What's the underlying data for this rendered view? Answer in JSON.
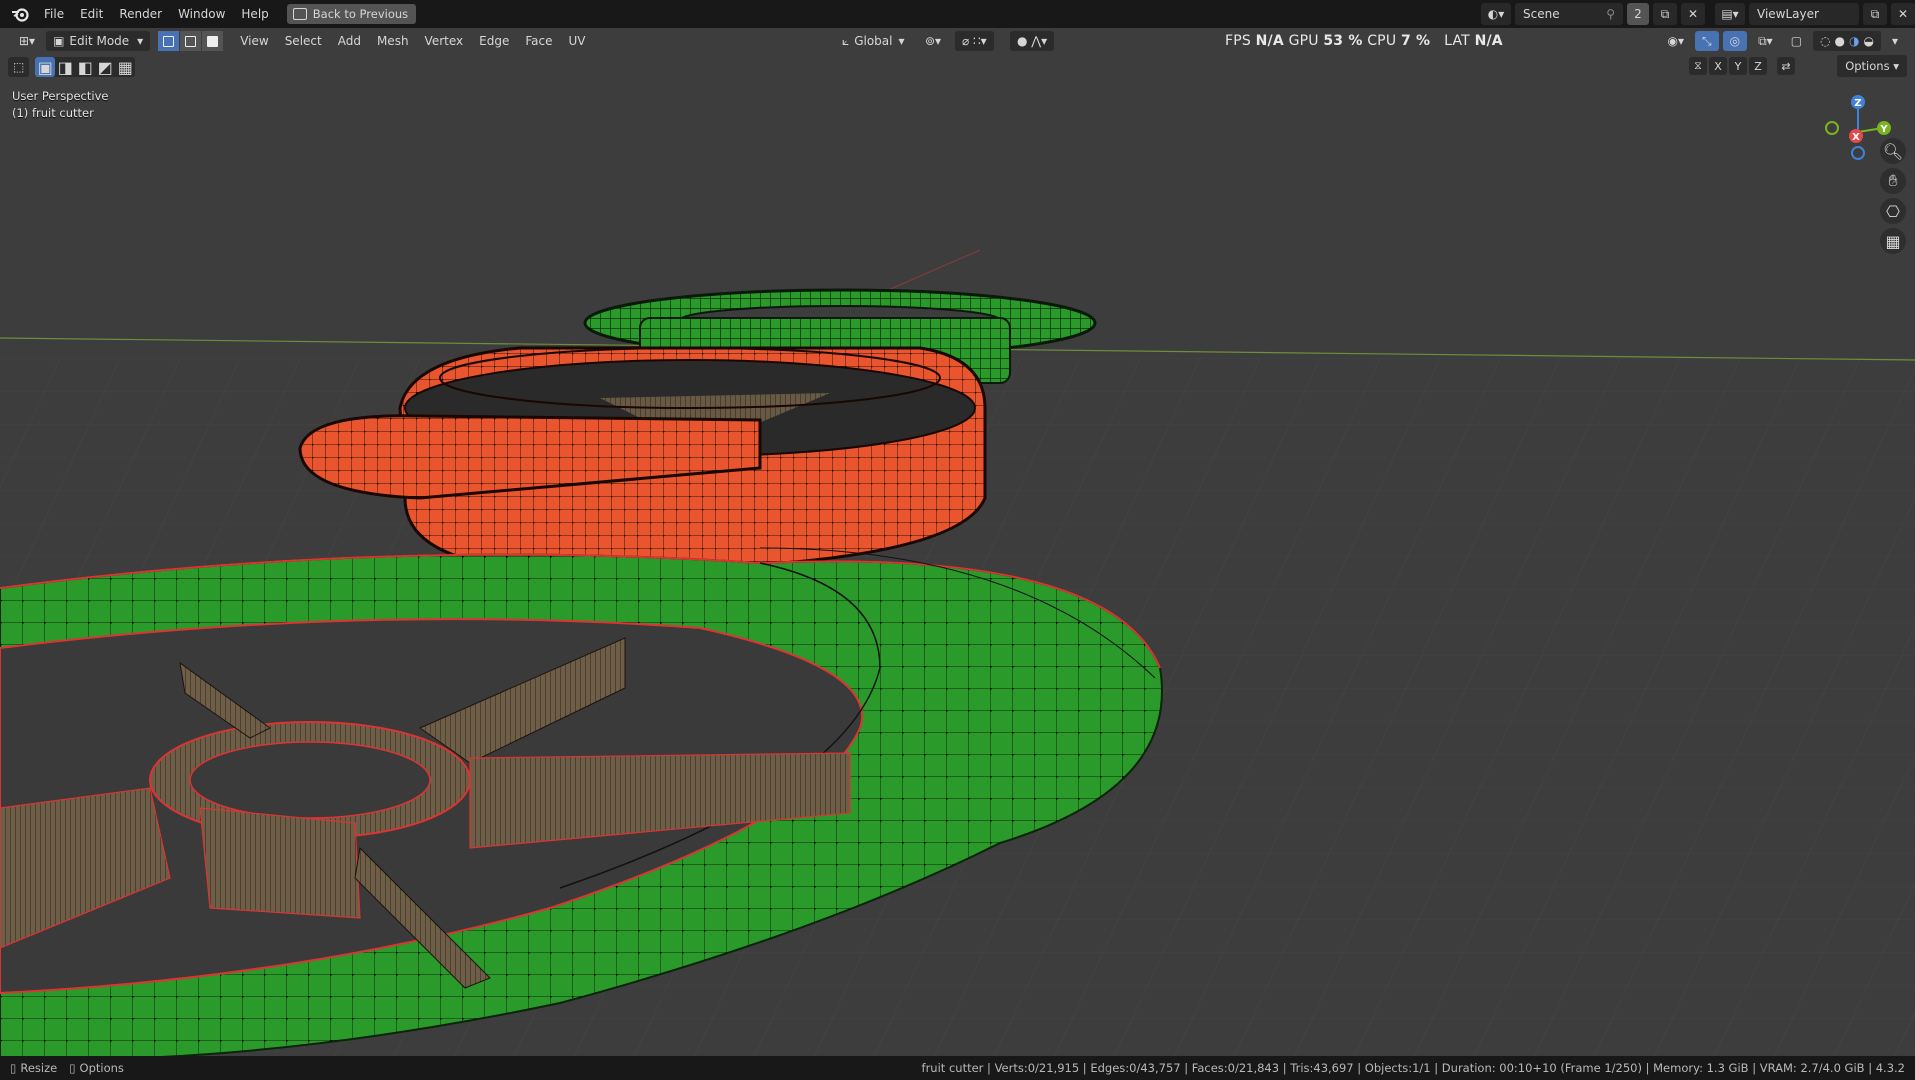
{
  "menubar": {
    "items": [
      "File",
      "Edit",
      "Render",
      "Window",
      "Help"
    ],
    "back_button": "Back to Previous",
    "scene_name": "Scene",
    "scene_count": "2",
    "view_layer": "ViewLayer"
  },
  "viewport_header": {
    "mode": "Edit Mode",
    "menus": [
      "View",
      "Select",
      "Add",
      "Mesh",
      "Vertex",
      "Edge",
      "Face",
      "UV"
    ],
    "transform_orientation": "Global",
    "options_label": "Options"
  },
  "perf": {
    "fps_label": "FPS",
    "fps_value": "N/A",
    "gpu_label": "GPU",
    "gpu_value": "53 %",
    "cpu_label": "CPU",
    "cpu_value": "7 %",
    "lat_label": "LAT",
    "lat_value": "N/A"
  },
  "viewport": {
    "perspective": "User Perspective",
    "object": "(1) fruit cutter"
  },
  "gizmo": {
    "z": "Z",
    "x": "X",
    "y": "Y",
    "axis_letters": [
      "X",
      "Y",
      "Z"
    ]
  },
  "statusbar": {
    "resize": "Resize",
    "options": "Options",
    "info": "fruit cutter | Verts:0/21,915 | Edges:0/43,757 | Faces:0/21,843 | Tris:43,697 | Objects:1/1 | Duration: 00:10+10 (Frame 1/250) | Memory: 1.3 GiB | VRAM: 2.7/4.0 GiB | 4.3.2"
  },
  "colors": {
    "accent": "#4772b3",
    "green_mesh": "#2a9a2a",
    "orange_mesh": "#e8552e",
    "blade": "#6b5a44"
  }
}
